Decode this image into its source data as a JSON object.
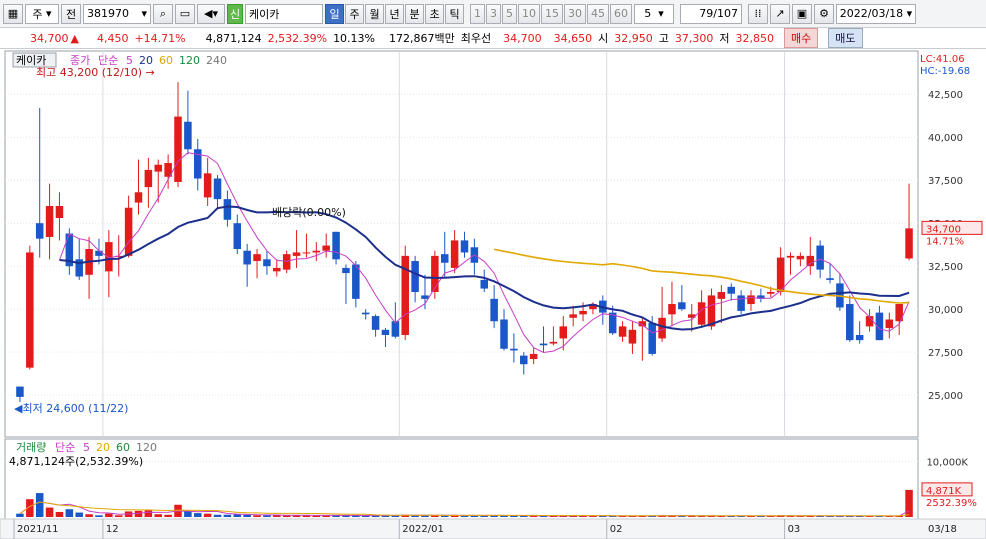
{
  "toolbar": {
    "chart_type": "주",
    "prev_label": "전",
    "stock_code": "381970",
    "badge": "신",
    "stock_name": "케이카",
    "periods": [
      "일",
      "주",
      "월",
      "년",
      "분",
      "초",
      "틱"
    ],
    "active_period": "일",
    "intervals": [
      "1",
      "3",
      "5",
      "10",
      "15",
      "30",
      "45",
      "60"
    ],
    "interval_value": "5",
    "page_counter": "79/107",
    "date": "2022/03/18"
  },
  "quote": {
    "price": "34,700",
    "change": "4,450",
    "change_pct": "+14.71%",
    "volume": "4,871,124",
    "volume_ratio": "2,532.39%",
    "turnover_rate": "10.13%",
    "trade_value": "172,867백만",
    "best_ask_label": "최우선",
    "best_ask": "34,700",
    "best_bid": "34,650",
    "open_label": "시",
    "open": "32,950",
    "high_label": "고",
    "high": "37,300",
    "low_label": "저",
    "low": "32,850",
    "buy_label": "매수",
    "sell_label": "매도"
  },
  "chart_data": {
    "type": "candlestick",
    "stock_name": "케이카",
    "legend_price": [
      "종가",
      "단순",
      "5",
      "20",
      "60",
      "120",
      "240"
    ],
    "legend_volume": [
      "거래량",
      "단순",
      "5",
      "20",
      "60",
      "120"
    ],
    "y_ticks": [
      "42,500",
      "40,000",
      "37,500",
      "35,000",
      "32,500",
      "30,000",
      "27,500",
      "25,000"
    ],
    "ylim": [
      22800,
      44200
    ],
    "volume_ticks": [
      "10,000K"
    ],
    "x_labels": [
      "2021/11",
      "12",
      "2022/01",
      "02",
      "03",
      "03/18"
    ],
    "lc": "LC:41.06",
    "hc": "HC:-19.68",
    "max_annotation": "최고 43,200 (12/10)",
    "min_annotation": "최저 24,600 (11/22)",
    "dividend_annotation": "배당락(0.00%)",
    "last_price_label": "34,700",
    "last_pct_label": "14.71%",
    "volume_last_label": "4,871K",
    "volume_pct_label": "2532.39%",
    "volume_header": "4,871,124주(2,532.39%)",
    "colors": {
      "up": "#e21b1b",
      "down": "#1a57c9",
      "ma5": "#c63ec6",
      "ma20": "#1c2f8c",
      "ma60": "#e0a800"
    },
    "candles": [
      {
        "o": 25500,
        "h": 25500,
        "l": 24600,
        "c": 24900,
        "v": 600
      },
      {
        "o": 26600,
        "h": 33700,
        "l": 26500,
        "c": 33300,
        "v": 3200
      },
      {
        "o": 35000,
        "h": 41700,
        "l": 33000,
        "c": 34100,
        "v": 4300
      },
      {
        "o": 34200,
        "h": 37300,
        "l": 32900,
        "c": 36000,
        "v": 1700
      },
      {
        "o": 35300,
        "h": 36800,
        "l": 34000,
        "c": 36000,
        "v": 900
      },
      {
        "o": 34400,
        "h": 34700,
        "l": 32000,
        "c": 32500,
        "v": 1400
      },
      {
        "o": 32900,
        "h": 34100,
        "l": 31700,
        "c": 31900,
        "v": 800
      },
      {
        "o": 32000,
        "h": 34200,
        "l": 30600,
        "c": 33500,
        "v": 500
      },
      {
        "o": 33400,
        "h": 34100,
        "l": 32600,
        "c": 33100,
        "v": 300
      },
      {
        "o": 32200,
        "h": 34600,
        "l": 30700,
        "c": 33900,
        "v": 600
      },
      {
        "o": 33100,
        "h": 34300,
        "l": 31900,
        "c": 33100,
        "v": 300
      },
      {
        "o": 33100,
        "h": 36600,
        "l": 33000,
        "c": 35900,
        "v": 1000
      },
      {
        "o": 36200,
        "h": 38700,
        "l": 35500,
        "c": 36800,
        "v": 1100
      },
      {
        "o": 37100,
        "h": 38800,
        "l": 35900,
        "c": 38100,
        "v": 1200
      },
      {
        "o": 38000,
        "h": 38700,
        "l": 36200,
        "c": 38400,
        "v": 500
      },
      {
        "o": 37700,
        "h": 39000,
        "l": 37000,
        "c": 38500,
        "v": 400
      },
      {
        "o": 37400,
        "h": 43200,
        "l": 37100,
        "c": 41200,
        "v": 2200
      },
      {
        "o": 40900,
        "h": 42700,
        "l": 39000,
        "c": 39300,
        "v": 1000
      },
      {
        "o": 39300,
        "h": 39900,
        "l": 36900,
        "c": 37600,
        "v": 700
      },
      {
        "o": 36500,
        "h": 38800,
        "l": 36000,
        "c": 37900,
        "v": 600
      },
      {
        "o": 37600,
        "h": 37800,
        "l": 35800,
        "c": 36400,
        "v": 400
      },
      {
        "o": 36400,
        "h": 36900,
        "l": 34800,
        "c": 35200,
        "v": 400
      },
      {
        "o": 35000,
        "h": 35500,
        "l": 33200,
        "c": 33500,
        "v": 500
      },
      {
        "o": 33400,
        "h": 33800,
        "l": 31300,
        "c": 32600,
        "v": 400
      },
      {
        "o": 32800,
        "h": 33500,
        "l": 31800,
        "c": 33200,
        "v": 300
      },
      {
        "o": 32900,
        "h": 33400,
        "l": 32000,
        "c": 32500,
        "v": 300
      },
      {
        "o": 32200,
        "h": 32900,
        "l": 31900,
        "c": 32400,
        "v": 300
      },
      {
        "o": 32300,
        "h": 33400,
        "l": 32100,
        "c": 33200,
        "v": 300
      },
      {
        "o": 33100,
        "h": 34600,
        "l": 32400,
        "c": 33300,
        "v": 300
      },
      {
        "o": 33300,
        "h": 34400,
        "l": 33000,
        "c": 33300,
        "v": 300
      },
      {
        "o": 33300,
        "h": 33900,
        "l": 32800,
        "c": 33400,
        "v": 250
      },
      {
        "o": 33400,
        "h": 34400,
        "l": 33000,
        "c": 33700,
        "v": 250
      },
      {
        "o": 34500,
        "h": 34500,
        "l": 32600,
        "c": 32900,
        "v": 300
      },
      {
        "o": 32400,
        "h": 32600,
        "l": 30300,
        "c": 32100,
        "v": 300
      },
      {
        "o": 32600,
        "h": 32800,
        "l": 30100,
        "c": 30600,
        "v": 300
      },
      {
        "o": 29800,
        "h": 30000,
        "l": 29400,
        "c": 29700,
        "v": 200
      },
      {
        "o": 29600,
        "h": 29700,
        "l": 28400,
        "c": 28800,
        "v": 300
      },
      {
        "o": 28800,
        "h": 28900,
        "l": 27800,
        "c": 28500,
        "v": 300
      },
      {
        "o": 29300,
        "h": 30400,
        "l": 28300,
        "c": 28400,
        "v": 300
      },
      {
        "o": 28500,
        "h": 33700,
        "l": 28200,
        "c": 33100,
        "v": 400
      },
      {
        "o": 32800,
        "h": 33100,
        "l": 30400,
        "c": 31000,
        "v": 300
      },
      {
        "o": 30800,
        "h": 32000,
        "l": 30000,
        "c": 30600,
        "v": 300
      },
      {
        "o": 31000,
        "h": 33400,
        "l": 30600,
        "c": 33100,
        "v": 300
      },
      {
        "o": 33200,
        "h": 34500,
        "l": 31800,
        "c": 32700,
        "v": 300
      },
      {
        "o": 32400,
        "h": 34600,
        "l": 32100,
        "c": 34000,
        "v": 300
      },
      {
        "o": 34000,
        "h": 34500,
        "l": 33000,
        "c": 33300,
        "v": 250
      },
      {
        "o": 33600,
        "h": 34100,
        "l": 32000,
        "c": 32700,
        "v": 250
      },
      {
        "o": 31700,
        "h": 32300,
        "l": 31000,
        "c": 31200,
        "v": 300
      },
      {
        "o": 30600,
        "h": 31400,
        "l": 28900,
        "c": 29300,
        "v": 300
      },
      {
        "o": 29400,
        "h": 30000,
        "l": 27600,
        "c": 27700,
        "v": 300
      },
      {
        "o": 27700,
        "h": 28600,
        "l": 26900,
        "c": 27600,
        "v": 200
      },
      {
        "o": 27300,
        "h": 27500,
        "l": 26200,
        "c": 26800,
        "v": 200
      },
      {
        "o": 27100,
        "h": 27800,
        "l": 26800,
        "c": 27400,
        "v": 200
      },
      {
        "o": 28000,
        "h": 29000,
        "l": 27500,
        "c": 27900,
        "v": 200
      },
      {
        "o": 28000,
        "h": 29000,
        "l": 27900,
        "c": 28100,
        "v": 200
      },
      {
        "o": 28300,
        "h": 29600,
        "l": 27600,
        "c": 29000,
        "v": 200
      },
      {
        "o": 29500,
        "h": 30200,
        "l": 29000,
        "c": 29700,
        "v": 250
      },
      {
        "o": 29700,
        "h": 30400,
        "l": 29300,
        "c": 29900,
        "v": 200
      },
      {
        "o": 30000,
        "h": 30400,
        "l": 29700,
        "c": 30300,
        "v": 200
      },
      {
        "o": 30500,
        "h": 30800,
        "l": 29100,
        "c": 29800,
        "v": 200
      },
      {
        "o": 29800,
        "h": 30200,
        "l": 28500,
        "c": 28600,
        "v": 200
      },
      {
        "o": 28400,
        "h": 29300,
        "l": 28100,
        "c": 29000,
        "v": 200
      },
      {
        "o": 28000,
        "h": 29300,
        "l": 27400,
        "c": 28800,
        "v": 200
      },
      {
        "o": 29000,
        "h": 29500,
        "l": 27000,
        "c": 29300,
        "v": 200
      },
      {
        "o": 29200,
        "h": 29600,
        "l": 27300,
        "c": 27400,
        "v": 250
      },
      {
        "o": 28300,
        "h": 31300,
        "l": 28100,
        "c": 29500,
        "v": 300
      },
      {
        "o": 29700,
        "h": 31600,
        "l": 29000,
        "c": 30300,
        "v": 300
      },
      {
        "o": 30400,
        "h": 31400,
        "l": 29900,
        "c": 30000,
        "v": 200
      },
      {
        "o": 29500,
        "h": 30300,
        "l": 28700,
        "c": 29700,
        "v": 200
      },
      {
        "o": 29100,
        "h": 31100,
        "l": 28900,
        "c": 30400,
        "v": 200
      },
      {
        "o": 29000,
        "h": 31200,
        "l": 28800,
        "c": 30800,
        "v": 200
      },
      {
        "o": 30600,
        "h": 31400,
        "l": 29200,
        "c": 31000,
        "v": 200
      },
      {
        "o": 31300,
        "h": 31500,
        "l": 30500,
        "c": 30900,
        "v": 200
      },
      {
        "o": 30800,
        "h": 31100,
        "l": 29700,
        "c": 29900,
        "v": 200
      },
      {
        "o": 30300,
        "h": 31100,
        "l": 29900,
        "c": 30800,
        "v": 200
      },
      {
        "o": 30800,
        "h": 31200,
        "l": 30400,
        "c": 30600,
        "v": 200
      },
      {
        "o": 30900,
        "h": 31300,
        "l": 30700,
        "c": 31000,
        "v": 200
      },
      {
        "o": 31000,
        "h": 33600,
        "l": 30800,
        "c": 33000,
        "v": 300
      },
      {
        "o": 33000,
        "h": 33300,
        "l": 32000,
        "c": 33100,
        "v": 200
      },
      {
        "o": 32900,
        "h": 33300,
        "l": 32500,
        "c": 33100,
        "v": 150
      },
      {
        "o": 32500,
        "h": 34200,
        "l": 32000,
        "c": 33100,
        "v": 200
      },
      {
        "o": 33700,
        "h": 34000,
        "l": 31800,
        "c": 32300,
        "v": 200
      },
      {
        "o": 31800,
        "h": 32700,
        "l": 31500,
        "c": 31700,
        "v": 200
      },
      {
        "o": 31500,
        "h": 32100,
        "l": 29900,
        "c": 30100,
        "v": 200
      },
      {
        "o": 30300,
        "h": 30800,
        "l": 28100,
        "c": 28200,
        "v": 200
      },
      {
        "o": 28500,
        "h": 29300,
        "l": 28000,
        "c": 28200,
        "v": 200
      },
      {
        "o": 29000,
        "h": 30000,
        "l": 28700,
        "c": 29600,
        "v": 200
      },
      {
        "o": 29800,
        "h": 30200,
        "l": 28200,
        "c": 28200,
        "v": 200
      },
      {
        "o": 28900,
        "h": 29800,
        "l": 28300,
        "c": 29400,
        "v": 150
      },
      {
        "o": 29300,
        "h": 30300,
        "l": 28500,
        "c": 30300,
        "v": 200
      },
      {
        "o": 32950,
        "h": 37300,
        "l": 32850,
        "c": 34700,
        "v": 4871
      }
    ]
  }
}
